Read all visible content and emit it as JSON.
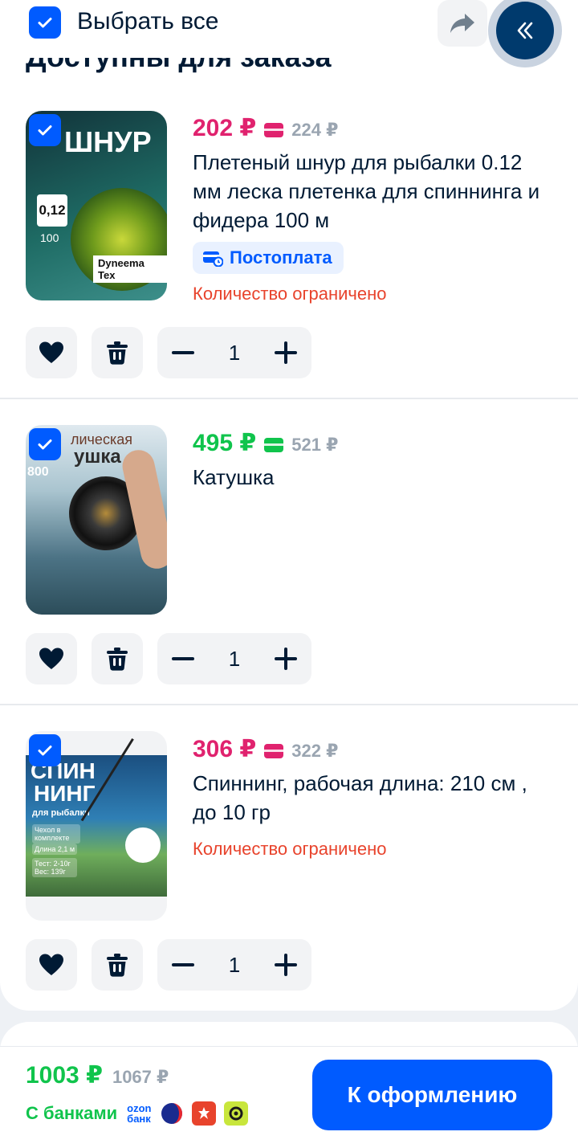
{
  "header": {
    "select_all_label": "Выбрать все",
    "section_title": "Доступны для заказа",
    "share_icon": "share-icon",
    "collapse_icon": "double-chevron-left-icon"
  },
  "items": [
    {
      "price": "202 ₽",
      "price_color": "#e0226e",
      "old_price": "224 ₽",
      "title": "Плетеный шнур для рыбалки 0.12 мм леска плетенка для спиннинга и фидера 100 м",
      "badge": "Постоплата",
      "limited": "Количество ограничено",
      "quantity": "1",
      "checked": true,
      "image": {
        "top_text": "ШНУР",
        "thickness": "0,12",
        "length": "100",
        "brand": "Dyneema Tex"
      }
    },
    {
      "price": "495 ₽",
      "price_color": "#10c44c",
      "old_price": "521 ₽",
      "title": "Катушка",
      "quantity": "1",
      "checked": true,
      "image": {
        "top_text": "лическая",
        "sub_text": "ушка",
        "side_text": "800"
      }
    },
    {
      "price": "306 ₽",
      "price_color": "#e0226e",
      "old_price": "322 ₽",
      "title": "Спиннинг, рабочая длина:  210 см , до 10 гр",
      "limited": "Количество ограничено",
      "quantity": "1",
      "checked": true,
      "image": {
        "line1": "СПИН",
        "line2": "НИНГ",
        "line3": "для рыбалки",
        "chip1": "Чехол в комплекте",
        "chip2": "Длина 2,1 м",
        "chip3": "Тест: 2-10г Вес: 139г"
      }
    }
  ],
  "bottom": {
    "total": "1003 ₽",
    "total_old": "1067 ₽",
    "banks_label": "С банками",
    "ozon_line1": "ozon",
    "ozon_line2": "банк",
    "checkout_label": "К оформлению"
  },
  "colors": {
    "accent": "#005bff",
    "green": "#10c44c",
    "pink": "#e0226e",
    "warning": "#e8432c"
  }
}
